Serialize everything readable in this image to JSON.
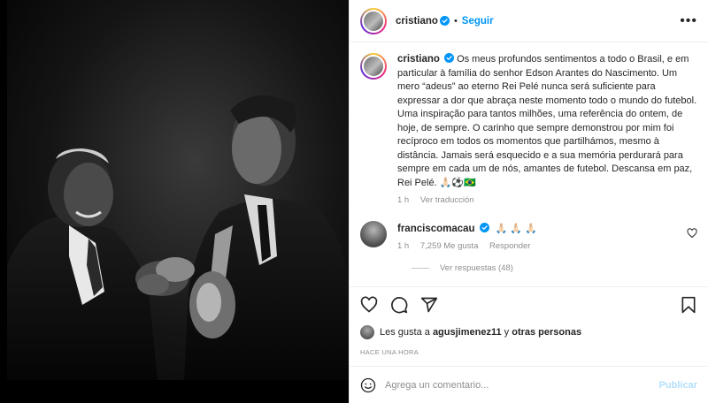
{
  "header": {
    "username": "cristiano",
    "separator": "•",
    "follow_label": "Seguir",
    "more_icon": "more-horizontal-icon"
  },
  "caption": {
    "username": "cristiano",
    "text": "Os meus profundos sentimentos a todo o Brasil, e em particular à família do senhor Edson Arantes do Nascimento. Um mero “adeus” ao eterno Rei Pelé nunca será suficiente para expressar a dor que abraça neste momento todo o mundo do futebol. Uma inspiração para tantos milhões, uma referência do ontem, de hoje, de sempre. O carinho que sempre demonstrou por mim foi recíproco em todos os momentos que partilhámos, mesmo à distância. Jamais será esquecido e a sua memória perdurará para sempre em cada um de nós, amantes de futebol. Descansa em paz, Rei Pelé.",
    "emojis": "🙏🏻⚽🇧🇷",
    "time": "1 h",
    "translate_label": "Ver traducción"
  },
  "comment": {
    "username": "franciscomacau",
    "emojis": "🙏🏻🙏🏻🙏🏻",
    "time": "1 h",
    "likes": "7,259 Me gusta",
    "reply_label": "Responder",
    "view_replies": "Ver respuestas (48)"
  },
  "likes_summary": {
    "prefix": "Les gusta a",
    "user": "agusjimenez11",
    "middle": "y",
    "others": "otras personas"
  },
  "posted_ago": "HACE UNA HORA",
  "composer": {
    "placeholder": "Agrega un comentario...",
    "publish_label": "Publicar"
  },
  "colors": {
    "accent": "#0095f6",
    "verified": "#0095f6",
    "muted": "#8e8e8e"
  }
}
